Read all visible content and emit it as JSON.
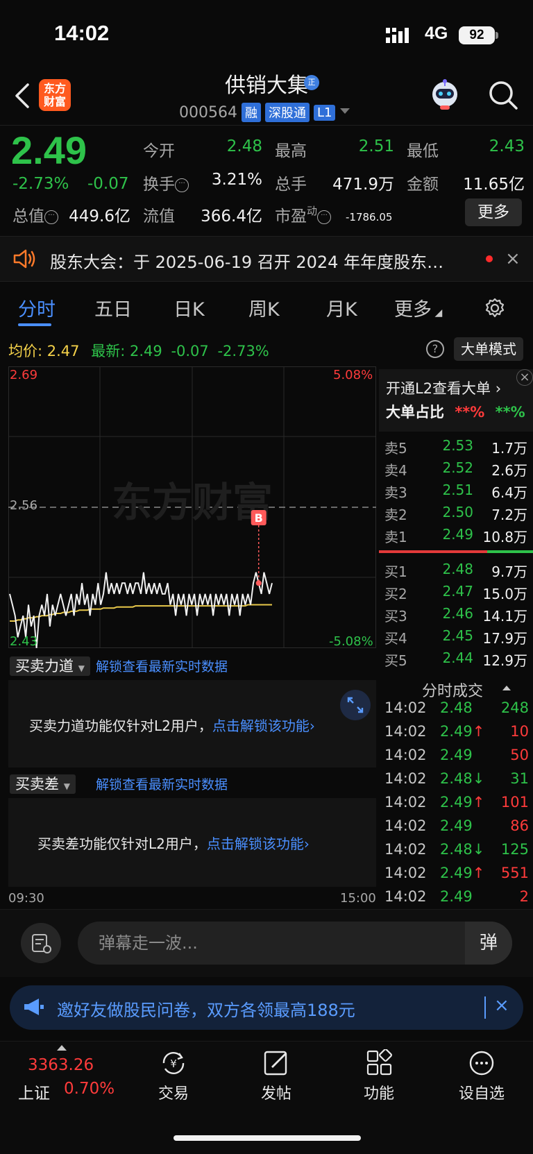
{
  "status_bar": {
    "time": "14:02",
    "network": "4G",
    "battery": "92"
  },
  "header": {
    "logo_text": "东方财富",
    "stock_name": "供销大集",
    "name_badge": "正",
    "stock_code": "000564",
    "tags": [
      "融",
      "深股通",
      "L1"
    ]
  },
  "quote": {
    "price": "2.49",
    "pct_change": "-2.73%",
    "abs_change": "-0.07",
    "fields": [
      {
        "label": "今开",
        "value": "2.48",
        "color": "#2ec24a"
      },
      {
        "label": "最高",
        "value": "2.51",
        "color": "#2ec24a"
      },
      {
        "label": "最低",
        "value": "2.43",
        "color": "#2ec24a"
      },
      {
        "label": "换手",
        "value": "3.21%",
        "color": "#f2f2f2"
      },
      {
        "label": "总手",
        "value": "471.9万",
        "color": "#f2f2f2"
      },
      {
        "label": "金额",
        "value": "11.65亿",
        "color": "#f2f2f2"
      },
      {
        "label": "总值",
        "value": "449.6亿",
        "color": "#f2f2f2"
      },
      {
        "label": "流值",
        "value": "366.4亿",
        "color": "#f2f2f2"
      },
      {
        "label": "市盈",
        "value": "-1786.05",
        "color": "#f2f2f2"
      }
    ],
    "pe_superscript": "动",
    "more_label": "更多"
  },
  "notice": {
    "text": "股东大会：于 2025-06-19 召开 2024 年年度股东…",
    "close": "×"
  },
  "tabs": [
    "分时",
    "五日",
    "日K",
    "周K",
    "月K",
    "更多"
  ],
  "avg_line": {
    "avg_label": "均价:",
    "avg_value": "2.47",
    "latest_label": "最新:",
    "latest_value": "2.49",
    "change": "-0.07",
    "pct": "-2.73%",
    "help": "?",
    "mode_button": "大单模式"
  },
  "chart": {
    "y_top": "2.69",
    "y_mid": "2.56",
    "y_bottom": "2.43",
    "pct_top": "5.08%",
    "pct_bottom": "-5.08%",
    "marker": "B",
    "watermark": "东方财富",
    "time_start": "09:30",
    "time_end": "15:00"
  },
  "chart_data": {
    "type": "line",
    "ylim": [
      2.43,
      2.69
    ],
    "reference_price": 2.56,
    "series_price": [
      2.48,
      2.47,
      2.46,
      2.44,
      2.45,
      2.46,
      2.44,
      2.47,
      2.45,
      2.46,
      2.43,
      2.46,
      2.47,
      2.46,
      2.48,
      2.45,
      2.47,
      2.46,
      2.47,
      2.48,
      2.47,
      2.46,
      2.47,
      2.48,
      2.46,
      2.48,
      2.47,
      2.49,
      2.47,
      2.48,
      2.46,
      2.48,
      2.47,
      2.49,
      2.47,
      2.48,
      2.5,
      2.48,
      2.49,
      2.48,
      2.49,
      2.48,
      2.49,
      2.49,
      2.48,
      2.49,
      2.48,
      2.49,
      2.49,
      2.48,
      2.5,
      2.48,
      2.49,
      2.48,
      2.49,
      2.48,
      2.49,
      2.48,
      2.48,
      2.49,
      2.47,
      2.48,
      2.46,
      2.48,
      2.47,
      2.48,
      2.46,
      2.48,
      2.47,
      2.48,
      2.46,
      2.48,
      2.47,
      2.48,
      2.47,
      2.48,
      2.46,
      2.48,
      2.47,
      2.48,
      2.47,
      2.48,
      2.46,
      2.48,
      2.47,
      2.48,
      2.46,
      2.48,
      2.47,
      2.48,
      2.47,
      2.49,
      2.5,
      2.49,
      2.48,
      2.5,
      2.49,
      2.48,
      2.49
    ],
    "series_avg": [
      2.455,
      2.455,
      2.455,
      2.456,
      2.456,
      2.457,
      2.457,
      2.458,
      2.458,
      2.458,
      2.459,
      2.459,
      2.46,
      2.46,
      2.46,
      2.461,
      2.461,
      2.462,
      2.462,
      2.462,
      2.463,
      2.463,
      2.463,
      2.464,
      2.464,
      2.464,
      2.465,
      2.465,
      2.465,
      2.465,
      2.466,
      2.466,
      2.466,
      2.466,
      2.466,
      2.467,
      2.467,
      2.467,
      2.467,
      2.467,
      2.468,
      2.468,
      2.468,
      2.468,
      2.468,
      2.468,
      2.468,
      2.469,
      2.469,
      2.469,
      2.469,
      2.469,
      2.469,
      2.469,
      2.469,
      2.469,
      2.469,
      2.469,
      2.469,
      2.469,
      2.469,
      2.469,
      2.469,
      2.469,
      2.469,
      2.469,
      2.469,
      2.469,
      2.469,
      2.469,
      2.469,
      2.469,
      2.469,
      2.469,
      2.469,
      2.469,
      2.469,
      2.469,
      2.469,
      2.469,
      2.469,
      2.469,
      2.469,
      2.469,
      2.469,
      2.469,
      2.469,
      2.469,
      2.469,
      2.47,
      2.47,
      2.47,
      2.47,
      2.47,
      2.47,
      2.47,
      2.47,
      2.47,
      2.47
    ]
  },
  "sub1": {
    "dropdown": "买卖力道",
    "link": "解锁查看最新实时数据",
    "msg": "买卖力道功能仅针对L2用户，",
    "msg_link": "点击解锁该功能"
  },
  "sub2": {
    "dropdown": "买卖差",
    "link": "解锁查看最新实时数据",
    "msg": "买卖差功能仅针对L2用户，",
    "msg_link": "点击解锁该功能"
  },
  "l2": {
    "link": "开通L2查看大单",
    "ratio_label": "大单占比",
    "ratio_buy": "**%",
    "ratio_sell": "**%"
  },
  "order_book": {
    "sells": [
      {
        "label": "卖5",
        "price": "2.53",
        "vol": "1.7万"
      },
      {
        "label": "卖4",
        "price": "2.52",
        "vol": "2.6万"
      },
      {
        "label": "卖3",
        "price": "2.51",
        "vol": "6.4万"
      },
      {
        "label": "卖2",
        "price": "2.50",
        "vol": "7.2万"
      },
      {
        "label": "卖1",
        "price": "2.49",
        "vol": "10.8万"
      }
    ],
    "buys": [
      {
        "label": "买1",
        "price": "2.48",
        "vol": "9.7万"
      },
      {
        "label": "买2",
        "price": "2.47",
        "vol": "15.0万"
      },
      {
        "label": "买3",
        "price": "2.46",
        "vol": "14.1万"
      },
      {
        "label": "买4",
        "price": "2.45",
        "vol": "17.9万"
      },
      {
        "label": "买5",
        "price": "2.44",
        "vol": "12.9万"
      }
    ]
  },
  "trades": {
    "title": "分时成交",
    "rows": [
      {
        "time": "14:02",
        "price": "2.48",
        "vol": "248",
        "vol_color": "#2ec24a"
      },
      {
        "time": "14:02",
        "price": "2.49↑",
        "vol": "10",
        "vol_color": "#ff3b3b"
      },
      {
        "time": "14:02",
        "price": "2.49",
        "vol": "50",
        "vol_color": "#ff3b3b"
      },
      {
        "time": "14:02",
        "price": "2.48↓",
        "vol": "31",
        "vol_color": "#2ec24a"
      },
      {
        "time": "14:02",
        "price": "2.49↑",
        "vol": "101",
        "vol_color": "#ff3b3b"
      },
      {
        "time": "14:02",
        "price": "2.49",
        "vol": "86",
        "vol_color": "#ff3b3b"
      },
      {
        "time": "14:02",
        "price": "2.48↓",
        "vol": "125",
        "vol_color": "#2ec24a"
      },
      {
        "time": "14:02",
        "price": "2.49↑",
        "vol": "551",
        "vol_color": "#ff3b3b"
      },
      {
        "time": "14:02",
        "price": "2.49",
        "vol": "2",
        "vol_color": "#ff3b3b"
      }
    ]
  },
  "comment": {
    "placeholder": "弹幕走一波...",
    "danmu": "弹"
  },
  "promo": {
    "text": "邀好友做股民问卷，双方各领最高188元",
    "close": "×"
  },
  "index": {
    "value": "3363.26",
    "name": "上证",
    "pct": "0.70%"
  },
  "nav": [
    "交易",
    "发帖",
    "功能",
    "设自选"
  ]
}
